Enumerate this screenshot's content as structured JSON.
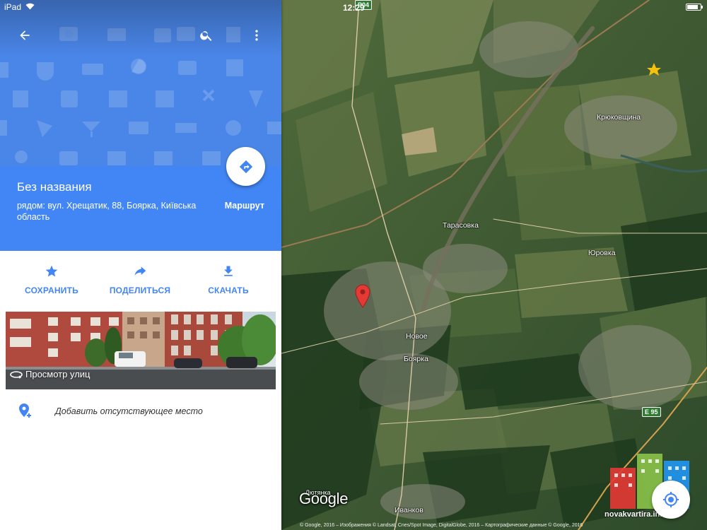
{
  "status_bar": {
    "device": "iPad",
    "time": "12:29",
    "battery_level": 0.85
  },
  "colors": {
    "brand_blue": "#4285f4",
    "hero_blue": "#4a86e8",
    "pin_red": "#e53935"
  },
  "appbar": {
    "back_icon": "arrow-back-icon",
    "search_icon": "search-icon",
    "menu_icon": "more-vert-icon"
  },
  "place": {
    "title": "Без названия",
    "address": "рядом: вул. Хрещатик, 88, Боярка, Київська область",
    "route_label": "Маршрут"
  },
  "actions": [
    {
      "label": "СОХРАНИТЬ",
      "icon": "star-icon"
    },
    {
      "label": "ПОДЕЛИТЬСЯ",
      "icon": "share-icon"
    },
    {
      "label": "СКАЧАТЬ",
      "icon": "download-icon"
    }
  ],
  "street_view": {
    "label": "Просмотр улиц"
  },
  "add_place": {
    "label": "Добавить отсутствующее место"
  },
  "map": {
    "labels": {
      "kryukovshchina": "Крюковщина",
      "tarasovka": "Тарасовка",
      "yurovka": "Юровка",
      "novoe": "Новое",
      "boyarka": "Боярка",
      "ivankov": "Иванков",
      "lyutyanka": "Лютянка"
    },
    "badges": {
      "r04": "Р04",
      "e95": "E 95"
    },
    "logo": "Google",
    "copyright": "© Google, 2016 – Изображения © Landsat, Cnes/Spot Image, DigitalGlobe, 2016 – Картографические данные © Google, 2016",
    "watermark": "novakvartira.in.ua"
  }
}
